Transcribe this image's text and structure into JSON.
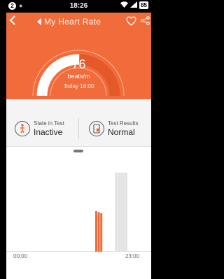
{
  "status_bar": {
    "notification_count": "2",
    "time": "18:26",
    "battery_level": "85"
  },
  "header": {
    "title": "My Heart Rate"
  },
  "gauge": {
    "value": "76",
    "unit": "beats/m",
    "timestamp": "Today 16:00",
    "scale_min": "0",
    "scale_max": "150",
    "fill_fraction": 0.507
  },
  "state_card": {
    "label": "State in Test",
    "value": "Inactive"
  },
  "result_card": {
    "label": "Test Results",
    "value": "Normal"
  },
  "chart_data": {
    "type": "bar",
    "x_start_label": "00:00",
    "x_end_label": "23:00",
    "colors": {
      "measured": "#f26b3a",
      "placeholder": "#e0e0e0"
    },
    "bars": [
      {
        "hour": 15.5,
        "value": 0.42,
        "kind": "measured"
      },
      {
        "hour": 16.0,
        "value": 0.41,
        "kind": "measured"
      },
      {
        "hour": 16.5,
        "value": 0.4,
        "kind": "measured"
      },
      {
        "hour": 19.5,
        "value": 0.82,
        "kind": "placeholder"
      },
      {
        "hour": 20.0,
        "value": 0.82,
        "kind": "placeholder"
      },
      {
        "hour": 20.5,
        "value": 0.82,
        "kind": "placeholder"
      },
      {
        "hour": 21.0,
        "value": 0.82,
        "kind": "placeholder"
      },
      {
        "hour": 21.5,
        "value": 0.82,
        "kind": "placeholder"
      }
    ]
  },
  "colors": {
    "accent": "#f26b3a",
    "accent_dark": "#e4582a"
  }
}
